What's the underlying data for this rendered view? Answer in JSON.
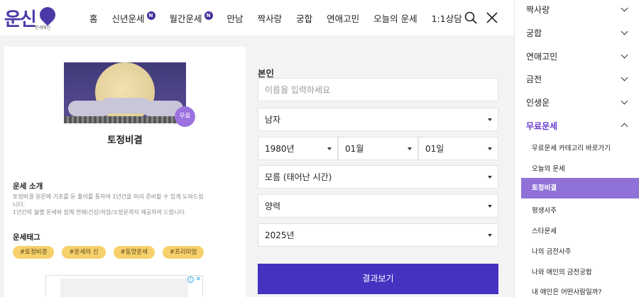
{
  "header": {
    "logo_text": "운신",
    "logo_sub": "운세에신",
    "nav": [
      {
        "label": "홈",
        "badge": ""
      },
      {
        "label": "신년운세",
        "badge": "N"
      },
      {
        "label": "월간운세",
        "badge": "N"
      },
      {
        "label": "만남",
        "badge": ""
      },
      {
        "label": "짝사랑",
        "badge": ""
      },
      {
        "label": "궁합",
        "badge": ""
      },
      {
        "label": "연애고민",
        "badge": ""
      },
      {
        "label": "오늘의 운세",
        "badge": ""
      },
      {
        "label": "1:1상담",
        "badge": ""
      }
    ]
  },
  "left": {
    "free_badge": "무료",
    "title": "토정비결",
    "intro_title": "운세 소개",
    "intro_lines": [
      "토정비결 원문에 기초를 둔 풀이를 통하여 1년간을 미리 준비할 수 있게 도와드립",
      "니다.",
      "1년간의 월별 운세와 함께 연애/건강/직장/소망운까지 제공하여 드립니다."
    ],
    "tags_title": "운세태그",
    "tags": [
      "#토정비결",
      "#운세의 신",
      "#동양운세",
      "#프리미엄"
    ]
  },
  "form": {
    "section_label": "본인",
    "name_placeholder": "이름을 입력하세요",
    "gender": "남자",
    "year": "1980년",
    "month": "01월",
    "day": "01일",
    "birth_time": "모름 (태어난 시간)",
    "calendar": "양력",
    "target_year": "2025년",
    "submit_label": "결과보기"
  },
  "sidebar": {
    "items": [
      "짝사랑",
      "궁합",
      "연애고민",
      "금전",
      "인생운",
      "무료운세"
    ],
    "sub_items": [
      "무료운세 카테고리 바로가기",
      "오늘의 운세",
      "토정비결",
      "평생사주",
      "스타운세",
      "나의 금전사주",
      "나와 애인의 금전궁합",
      "내 애인은 어떤사람일까?"
    ]
  },
  "colors": {
    "brand": "#4433c1",
    "sidebar_selected": "#8f71d8",
    "tag": "#f6d06a"
  }
}
